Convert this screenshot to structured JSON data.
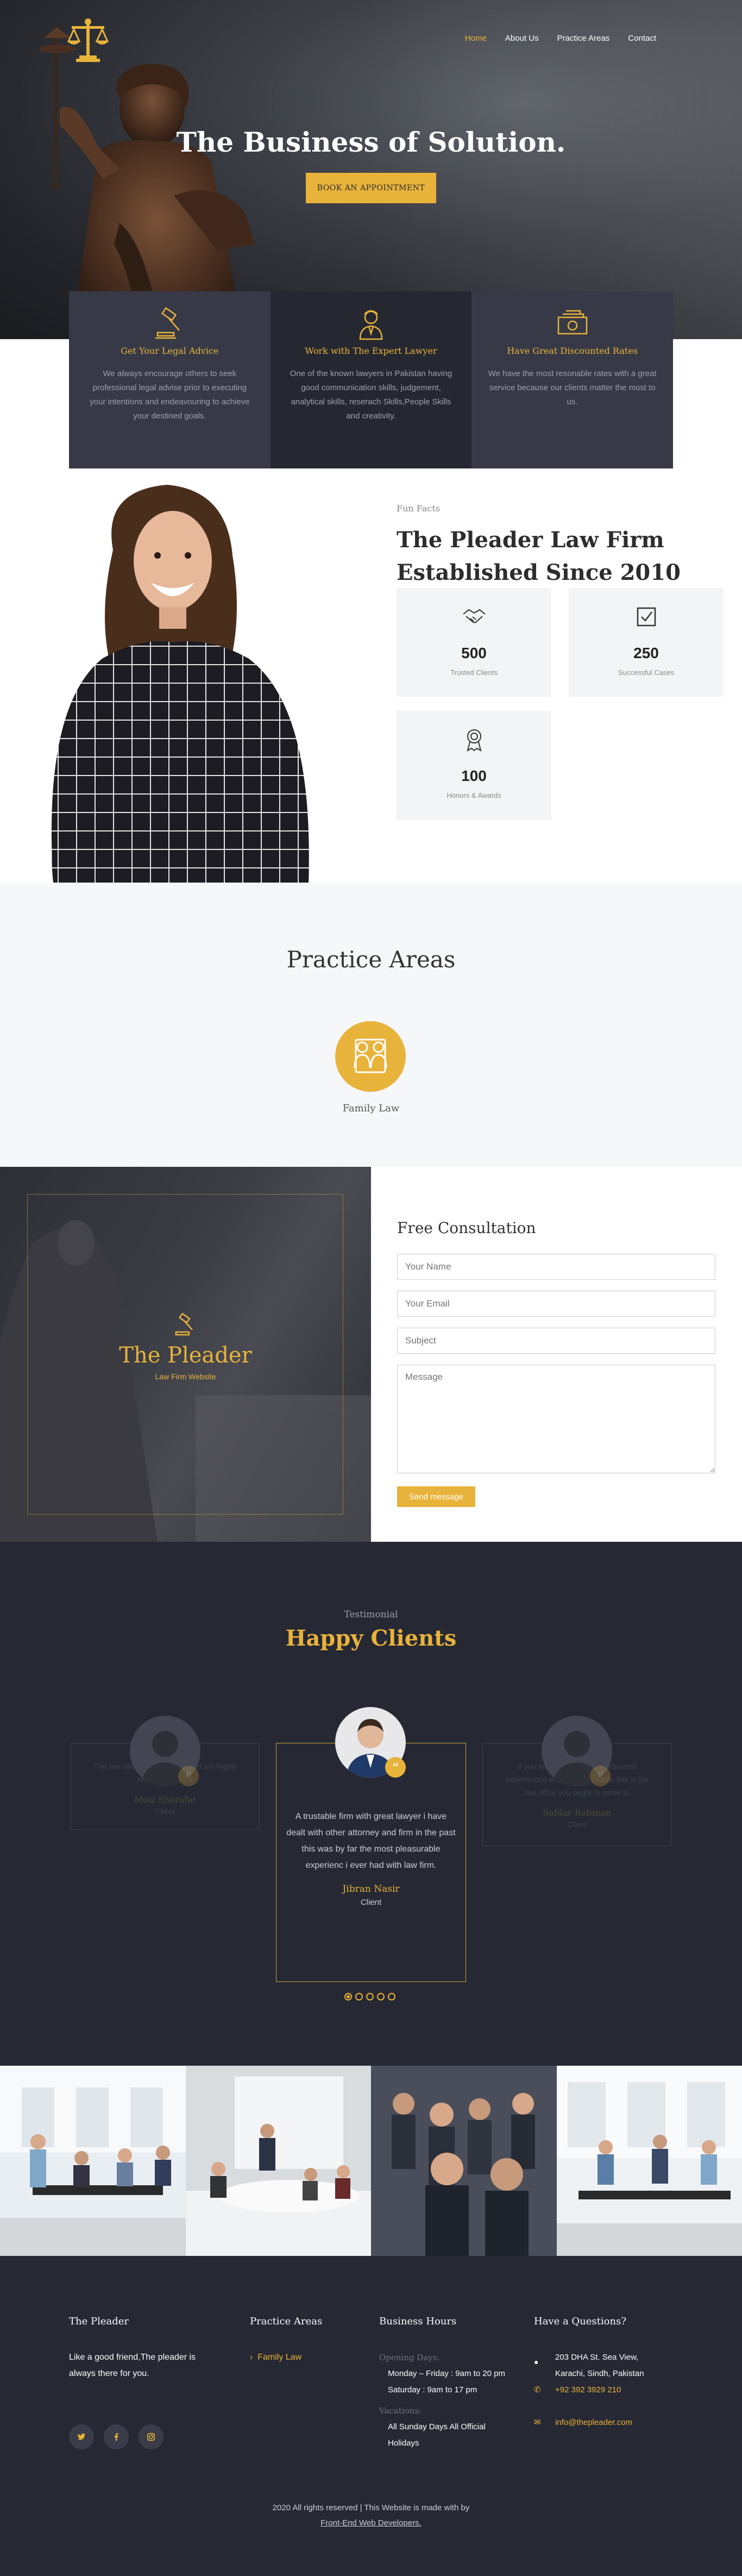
{
  "nav": {
    "items": [
      {
        "label": "Home",
        "active": true
      },
      {
        "label": "About Us"
      },
      {
        "label": "Practice Areas"
      },
      {
        "label": "Contact"
      }
    ]
  },
  "hero": {
    "title": "The Business of Solution.",
    "button": "BOOK AN APPOINTMENT"
  },
  "features": [
    {
      "icon": "gavel-icon",
      "title": "Get Your Legal Advice",
      "text": "We always encourage others to seek professional legal advise prior to executing your intentions and endeavouring to achieve your destined goals."
    },
    {
      "icon": "lawyer-icon",
      "title": "Work with The Expert Lawyer",
      "text": "One of the known lawyers in Pakistan having good communication skills, judgement, analytical skills, reserach Skills,People Skills and creativity."
    },
    {
      "icon": "money-icon",
      "title": "Have Great Discounted Rates",
      "text": "We have the most resonable rates with a great service because our clients matter the most to us."
    }
  ],
  "about": {
    "label": "Fun Facts",
    "title": "The Pleader Law Firm Established Since 2010",
    "stats": [
      {
        "icon": "handshake-icon",
        "value": "500",
        "label": "Trusted Clients"
      },
      {
        "icon": "checkbox-icon",
        "value": "250",
        "label": "Successful Cases"
      },
      {
        "icon": "award-icon",
        "value": "100",
        "label": "Honors & Awards"
      }
    ]
  },
  "practice": {
    "title": "Practice Areas",
    "items": [
      {
        "icon": "family-icon",
        "label": "Family Law"
      }
    ]
  },
  "consultation": {
    "brand": "The Pleader",
    "tagline": "Law Firm Website",
    "title": "Free Consultation",
    "name_placeholder": "Your Name",
    "email_placeholder": "Your Email",
    "subject_placeholder": "Subject",
    "message_placeholder": "Message",
    "send": "Send message"
  },
  "testimonials": {
    "subtitle": "Testimonial",
    "title": "Happy Clients",
    "items": [
      {
        "text": "The law office services provided are highly recommended a",
        "name": "Moiz Sharafat",
        "role": "Client"
      },
      {
        "text": "A trustable firm with great lawyer i have dealt with other attorney and firm in the past this was by far the most pleasurable experienc i ever had with law firm.",
        "name": "Jibran Nasir",
        "role": "Client"
      },
      {
        "text": "If you are looking for a professional experienced and knowledgeable this is the law office you ought to come to",
        "name": "Safdar Rehman",
        "role": "Client"
      }
    ]
  },
  "footer": {
    "col1": {
      "title": "The Pleader",
      "text": "Like a good friend,The pleader is always there for you."
    },
    "col2": {
      "title": "Practice Areas",
      "link": "Family Law"
    },
    "col3": {
      "title": "Business Hours",
      "opening_label": "Opening Days:",
      "opening_text": "Monday – Friday : 9am to 20 pm Saturday : 9am to 17 pm",
      "vacation_label": "Vacations:",
      "vacation_text": "All Sunday Days All Official Holidays"
    },
    "col4": {
      "title": "Have a Questions?",
      "address": "203 DHA St. Sea View, Karachi, Sindh, Pakistan",
      "phone": "+92 392 3929 210",
      "email": "info@thepleader.com"
    },
    "copyright": "2020 All rights reserved | This Website is made with by",
    "developer": "Front-End Web Developers."
  }
}
